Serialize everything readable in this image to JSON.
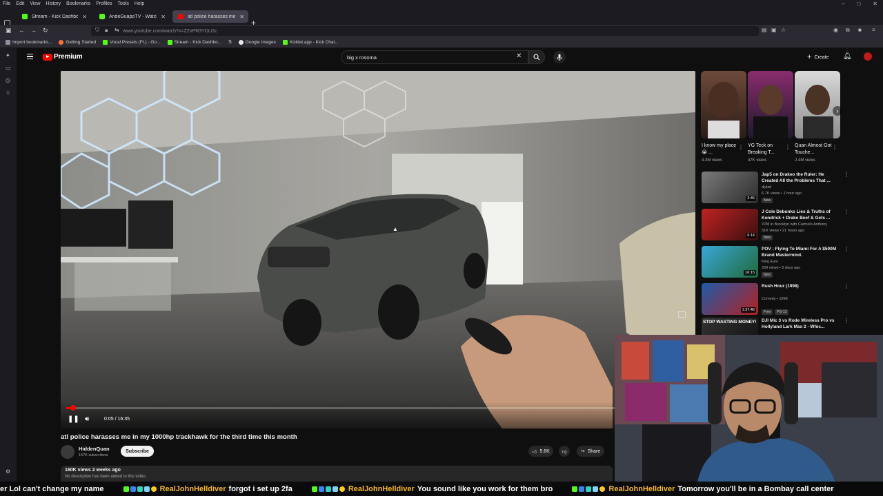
{
  "menubar": {
    "items": [
      "File",
      "Edit",
      "View",
      "History",
      "Bookmarks",
      "Profiles",
      "Tools",
      "Help"
    ]
  },
  "tabs": [
    {
      "label": "Stream - Kick Dashboard",
      "color": "#53fc18"
    },
    {
      "label": "AndeGuapoTV - Watch the VO",
      "color": "#53fc18"
    },
    {
      "label": "atl police harasses me in m",
      "color": "#ff0000"
    }
  ],
  "url": "www.youtube.com/watch?v=ZZxPR3YDLGc",
  "bookmarks": [
    {
      "label": "Import bookmarks...",
      "color": "#8f8f9d"
    },
    {
      "label": "Getting Started",
      "color": "#ff7139"
    },
    {
      "label": "Vocal Presets (FL) - Go...",
      "color": "#53fc18"
    },
    {
      "label": "Stream - Kick Dashbo...",
      "color": "#53fc18"
    },
    {
      "label": "Google Images",
      "color": "#e8e8e8"
    },
    {
      "label": "Kicklet.app - Kick Chat...",
      "color": "#53fc18"
    }
  ],
  "youtube": {
    "logo": "Premium",
    "search_query": "big x rosoma",
    "create_label": "Create",
    "player": {
      "time": "0:05 / 16:35",
      "progress_fraction": 0.005
    },
    "video_title": "atl police harasses me in my 1000hp trackhawk for the third time this month",
    "channel_name": "HiddenQuan",
    "subscribers": "157K subscribers",
    "subscribe_label": "Subscribe",
    "likes": "5.6K",
    "share_label": "Share",
    "desc_meta": "160K views  2 weeks ago",
    "desc_text": "No description has been added to this video."
  },
  "shorts": [
    {
      "title": "I know my place 😭 ...",
      "views": "4.3M views"
    },
    {
      "title": "YG Teck on Breaking T...",
      "views": "47K views"
    },
    {
      "title": "Quan Almost Got Touche...",
      "views": "2.4M views"
    }
  ],
  "recommendations": [
    {
      "title": "Jap5 on Drakeo the Ruler: He Created All the Problems That ...",
      "channel": "djvlad",
      "views": "6.7K views • 1 hour ago",
      "duration": "3:46",
      "badge": "New",
      "badge2": ""
    },
    {
      "title": "J Cole Debunks Lies & Truths of Kendrick + Drake Beef & Gets ...",
      "channel": "7PM in Brooklyn with Carmelo Anthony",
      "views": "51K views • 21 hours ago",
      "duration": "6:14",
      "badge": "New",
      "badge2": ""
    },
    {
      "title": "POV : Flying To Miami For A $500M Brand Mastermind.",
      "channel": "King Euro",
      "views": "339 views • 5 days ago",
      "duration": "16:15",
      "badge": "New",
      "badge2": ""
    },
    {
      "title": "Rush Hour (1998)",
      "channel": "Comedy • 1998",
      "views": "",
      "duration": "1:37:46",
      "badge": "Free",
      "badge2": "PG-13"
    },
    {
      "title": "DJI Mic 3 vs Rode Wireless Pro vs Hollyland Lark Max 2 - Whic...",
      "channel": "",
      "views": "",
      "duration": "",
      "badge": "",
      "badge2": "",
      "thumb_text": "STOP WASTING MONEY!"
    }
  ],
  "chat": [
    {
      "user": "",
      "message": "er Lol can't change my name"
    },
    {
      "user": "RealJohnHelldiver",
      "message": "forgot i set up 2fa"
    },
    {
      "user": "RealJohnHelldiver",
      "message": "You sound like you work for them bro"
    },
    {
      "user": "RealJohnHelldiver",
      "message": "Tomorrow you'll be in a Bombay call center"
    }
  ]
}
